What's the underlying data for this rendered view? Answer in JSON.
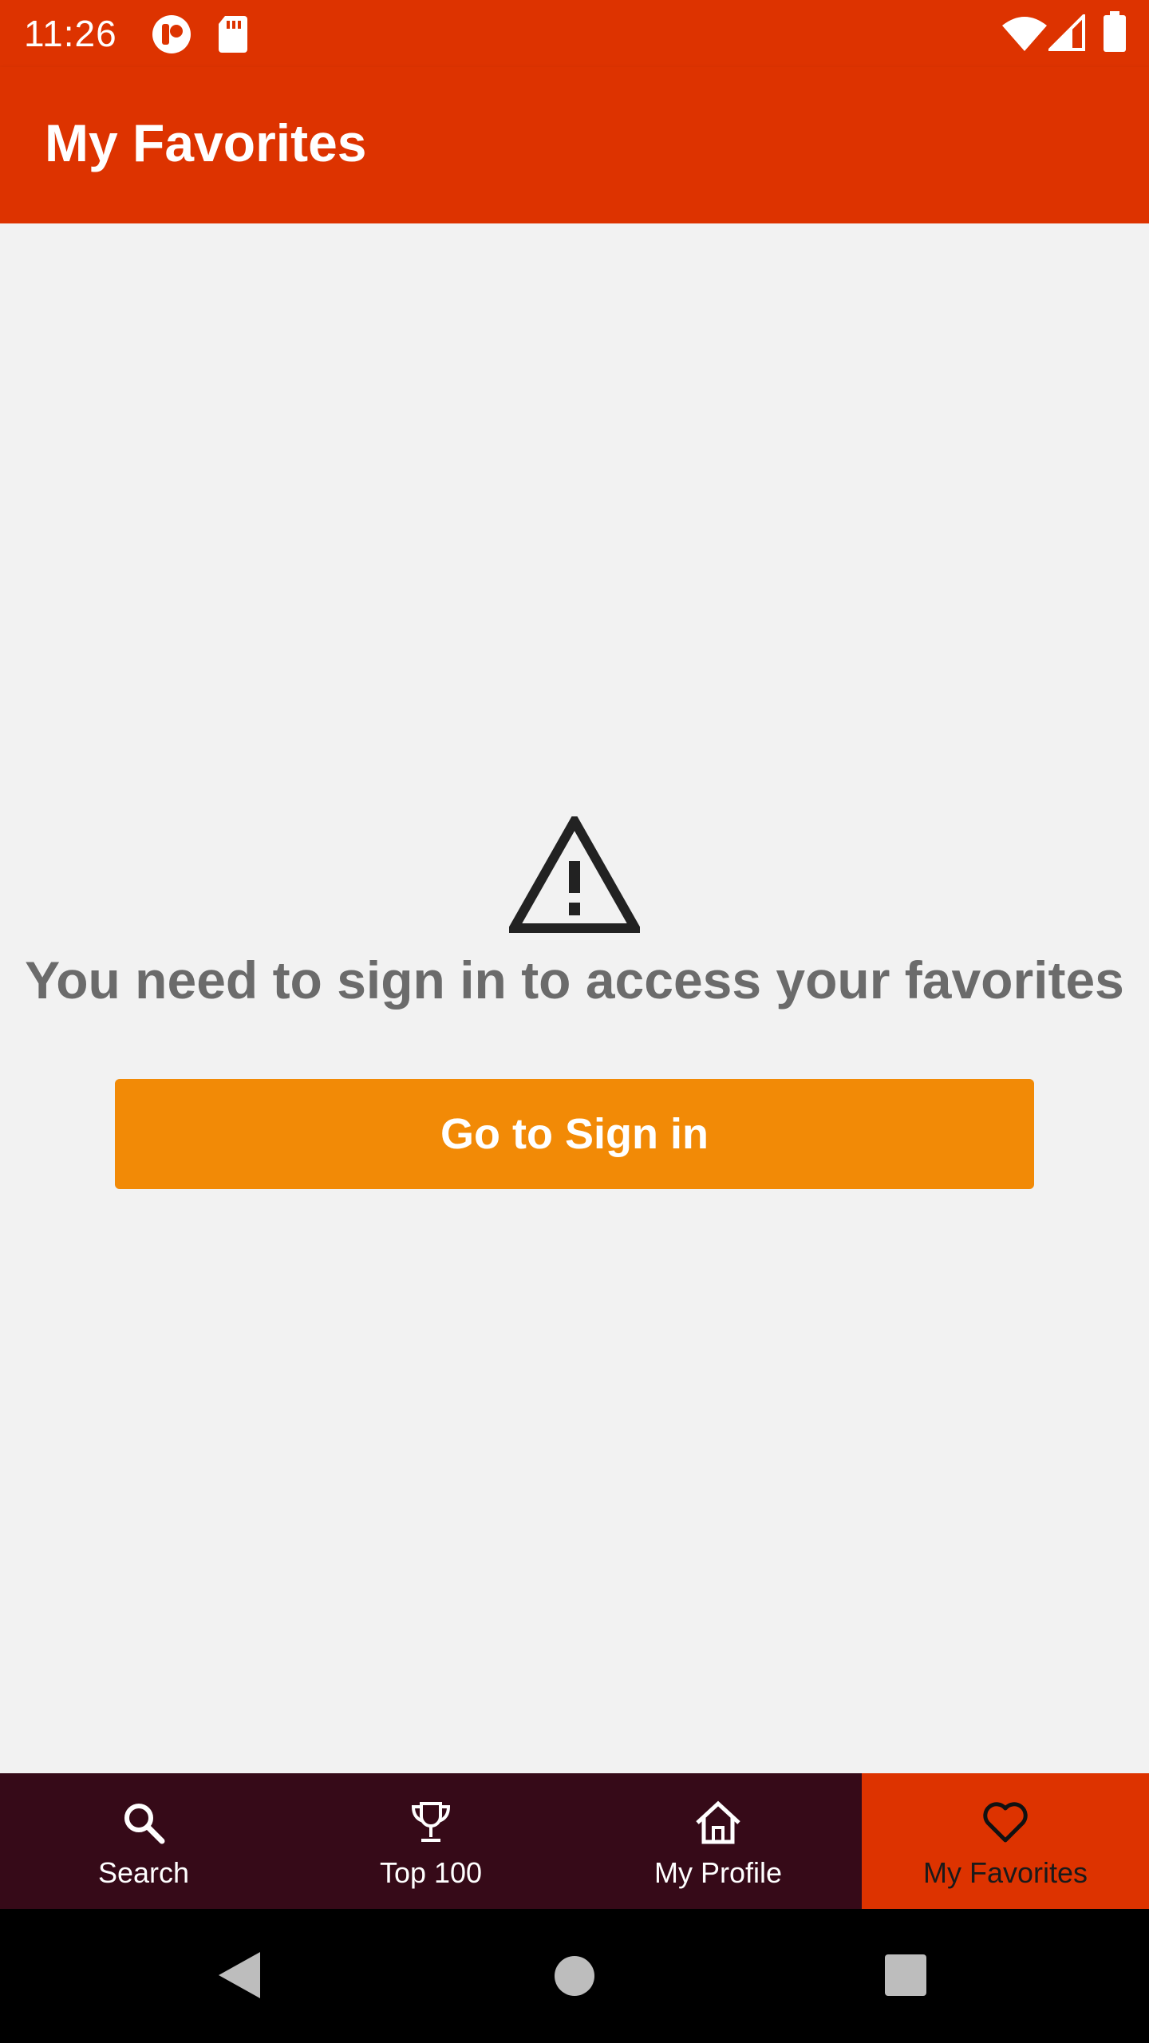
{
  "status_bar": {
    "time": "11:26",
    "left_icons": [
      "app-notification-icon",
      "sd-card-icon"
    ],
    "right_icons": [
      "wifi-icon",
      "cell-signal-icon",
      "battery-icon"
    ],
    "background": "#dd3300"
  },
  "app_bar": {
    "title": "My Favorites",
    "background": "#dd3300"
  },
  "main": {
    "icon": "warning-icon",
    "message": "You need to sign in to access your favorites",
    "button_label": "Go to Sign in",
    "button_color": "#f28a06",
    "message_color": "#6b6b6b"
  },
  "bottom_nav": {
    "background": "#360a18",
    "active_background": "#dd3300",
    "items": [
      {
        "label": "Search",
        "icon": "search-icon",
        "active": false
      },
      {
        "label": "Top 100",
        "icon": "trophy-icon",
        "active": false
      },
      {
        "label": "My Profile",
        "icon": "home-icon",
        "active": false
      },
      {
        "label": "My Favorites",
        "icon": "heart-icon",
        "active": true
      }
    ]
  },
  "system_nav": {
    "buttons": [
      "back-icon",
      "home-circle-icon",
      "recents-icon"
    ]
  }
}
